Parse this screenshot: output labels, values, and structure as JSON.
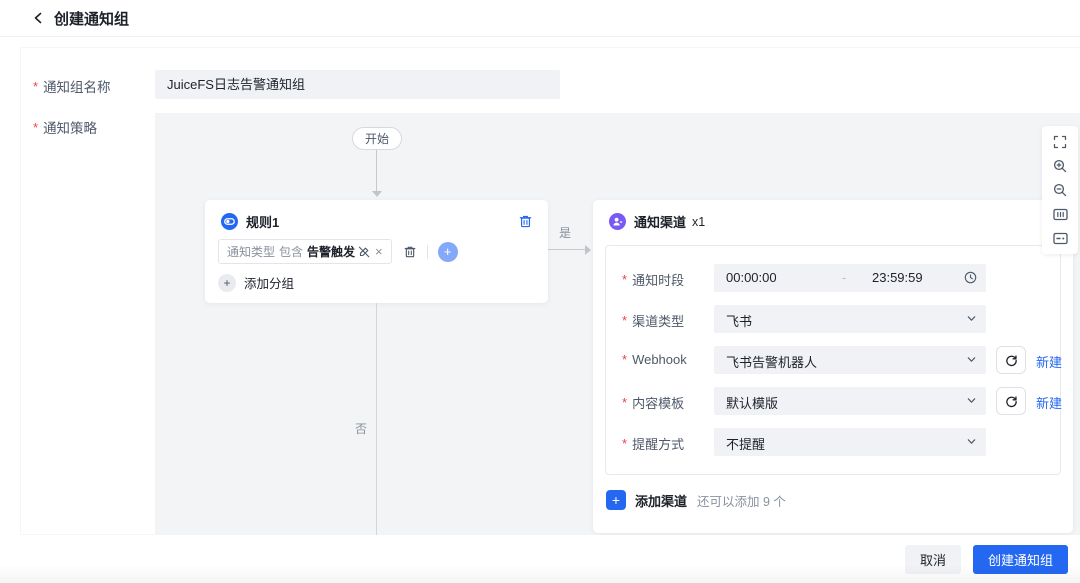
{
  "page": {
    "title": "创建通知组",
    "required_mark": "*"
  },
  "form": {
    "name_field": {
      "label": "通知组名称",
      "value": "JuiceFS日志告警通知组"
    },
    "strategy_field": {
      "label": "通知策略"
    }
  },
  "flow": {
    "start_label": "开始",
    "yes_label": "是",
    "no_label": "否",
    "rule_card": {
      "title": "规则1",
      "condition_field": "通知类型",
      "condition_operator": "包含",
      "condition_value": "告警触发",
      "condition_remove": "×",
      "add_icon": "+",
      "add_group": "添加分组"
    },
    "channel_card": {
      "title": "通知渠道",
      "count": "x1",
      "rows": [
        {
          "label": "通知时段",
          "start": "00:00:00",
          "separator": "-",
          "end": "23:59:59"
        },
        {
          "label": "渠道类型",
          "value": "飞书"
        },
        {
          "label": "Webhook",
          "value": "飞书告警机器人",
          "action": "新建"
        },
        {
          "label": "内容模板",
          "value": "默认模版",
          "action": "新建"
        },
        {
          "label": "提醒方式",
          "value": "不提醒"
        }
      ],
      "add_icon": "+",
      "add_channel": "添加渠道",
      "add_channel_hint": "还可以添加 9 个"
    },
    "toolbar_icons": [
      "fullscreen",
      "zoom-in",
      "zoom-out",
      "actual-size",
      "minimap"
    ]
  },
  "footer": {
    "cancel": "取消",
    "submit": "创建通知组"
  },
  "colors": {
    "primary": "#2468f2",
    "purple": "#7a58f6",
    "canvas_bg": "#f3f4f6",
    "input_bg": "#f0f2f5",
    "danger": "#f53f3f"
  }
}
